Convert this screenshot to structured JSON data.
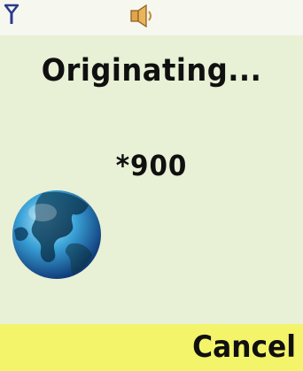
{
  "status_bar": {
    "signal_icon": "signal-antenna-icon",
    "sound_icon": "speaker-icon"
  },
  "call": {
    "status": "Originating...",
    "number": "*900",
    "image": "globe-icon"
  },
  "softkeys": {
    "right_label": "Cancel"
  },
  "colors": {
    "background": "#e8f0d5",
    "softkey_bar": "#f4f46a",
    "status_bar": "#f6f7ef",
    "text": "#101010"
  }
}
